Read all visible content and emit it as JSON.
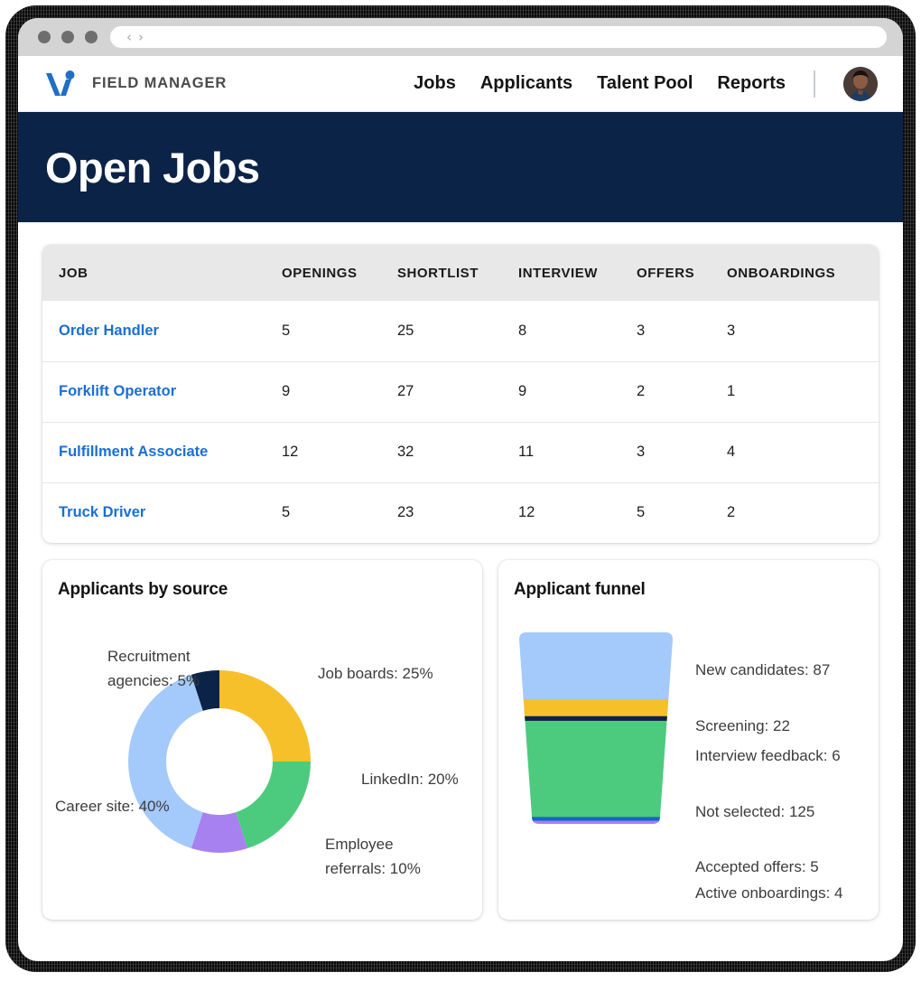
{
  "browser": {
    "traffic_lights": [
      "close",
      "minimize",
      "maximize"
    ],
    "back_glyph": "‹",
    "forward_glyph": "›",
    "url_value": ""
  },
  "navbar": {
    "brand": "FIELD MANAGER",
    "logo_name": "v-logo",
    "links": [
      {
        "label": "Jobs"
      },
      {
        "label": "Applicants"
      },
      {
        "label": "Talent Pool"
      },
      {
        "label": "Reports"
      }
    ]
  },
  "hero": {
    "title": "Open Jobs",
    "bg": "#0b2347"
  },
  "jobs_table": {
    "columns": [
      "JOB",
      "OPENINGS",
      "SHORTLIST",
      "INTERVIEW",
      "OFFERS",
      "ONBOARDINGS"
    ],
    "rows": [
      {
        "job": "Order Handler",
        "openings": "5",
        "shortlist": "25",
        "interview": "8",
        "offers": "3",
        "onboardings": "3"
      },
      {
        "job": "Forklift Operator",
        "openings": "9",
        "shortlist": "27",
        "interview": "9",
        "offers": "2",
        "onboardings": "1"
      },
      {
        "job": "Fulfillment Associate",
        "openings": "12",
        "shortlist": "32",
        "interview": "11",
        "offers": "3",
        "onboardings": "4"
      },
      {
        "job": "Truck Driver",
        "openings": "5",
        "shortlist": "23",
        "interview": "12",
        "offers": "5",
        "onboardings": "2"
      }
    ],
    "link_color": "#1a6fd4"
  },
  "chart_data": [
    {
      "type": "pie",
      "title": "Applicants by source",
      "donut": true,
      "legend_position": "callout-labels",
      "categories": [
        "Job boards",
        "LinkedIn",
        "Employee referrals",
        "Career site",
        "Recruitment agencies"
      ],
      "values": [
        25,
        20,
        10,
        40,
        5
      ],
      "unit": "%",
      "colors": [
        "#f5c02a",
        "#4ccb7e",
        "#a781f0",
        "#a4c9fb",
        "#0b2347"
      ],
      "labels": [
        "Job boards: 25%",
        "LinkedIn: 20%",
        "Employee referrals: 10%",
        "Career site: 40%",
        "Recruitment agencies: 5%"
      ]
    },
    {
      "type": "bar",
      "title": "Applicant funnel",
      "orientation": "funnel",
      "categories": [
        "New candidates",
        "Screening",
        "Interview feedback",
        "Not selected",
        "Accepted offers",
        "Active onboardings"
      ],
      "values": [
        87,
        22,
        6,
        125,
        5,
        4
      ],
      "colors": [
        "#a4c9fb",
        "#f5c02a",
        "#0b2347",
        "#4ccb7e",
        "#1565c8",
        "#a781f0"
      ],
      "labels": [
        "New candidates: 87",
        "Screening: 22",
        "Interview feedback: 6",
        "Not selected: 125",
        "Accepted offers: 5",
        "Active onboardings: 4"
      ]
    }
  ]
}
